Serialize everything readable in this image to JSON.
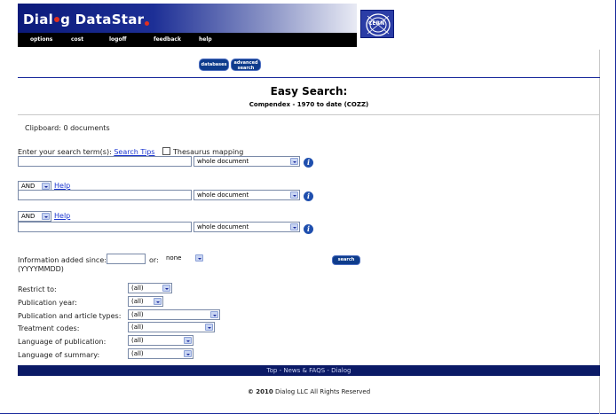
{
  "header": {
    "logo": {
      "before": "Dial",
      "after": "g DataStar"
    },
    "nav": [
      "options",
      "cost",
      "logoff",
      "feedback",
      "help"
    ],
    "cern_logo": "CERN"
  },
  "buttons": {
    "databases": "databases",
    "advanced_line1": "advanced",
    "advanced_line2": "search"
  },
  "page": {
    "title": "Easy Search:",
    "database": "Compendex - 1970 to date (COZZ)",
    "clipboard": "Clipboard: 0 documents"
  },
  "search": {
    "prompt": "Enter your search term(s):",
    "tips": "Search Tips",
    "thesaurus_label": "Thesaurus mapping",
    "help": "Help",
    "rows": [
      {
        "term": "",
        "field": "whole document"
      },
      {
        "operator": "AND",
        "term": "",
        "field": "whole document"
      },
      {
        "operator": "AND",
        "term": "",
        "field": "whole document"
      }
    ],
    "info_icon": "info-icon",
    "info_glyph": "i"
  },
  "since": {
    "label1": "Information added since:",
    "label2": "(YYYYMMDD)",
    "value": "",
    "or_label": "or:",
    "or_value": "none"
  },
  "search_button": "search",
  "restrict": {
    "items": [
      {
        "label": "Restrict to:",
        "value": "(all)"
      },
      {
        "label": "Publication year:",
        "value": "(all)"
      },
      {
        "label": "Publication and article types:",
        "value": "(all)"
      },
      {
        "label": "Treatment codes:",
        "value": "(all)"
      },
      {
        "label": "Language of publication:",
        "value": "(all)"
      },
      {
        "label": "Language of summary:",
        "value": "(all)"
      }
    ]
  },
  "footer": {
    "links": "Top - News & FAQS - Dialog",
    "copyright_year": "© 2010",
    "copyright_rest": " Dialog LLC All Rights Reserved"
  },
  "colors": {
    "brand": "#0b1a7a",
    "button": "#0e3c8c",
    "link": "#1a35d0"
  }
}
